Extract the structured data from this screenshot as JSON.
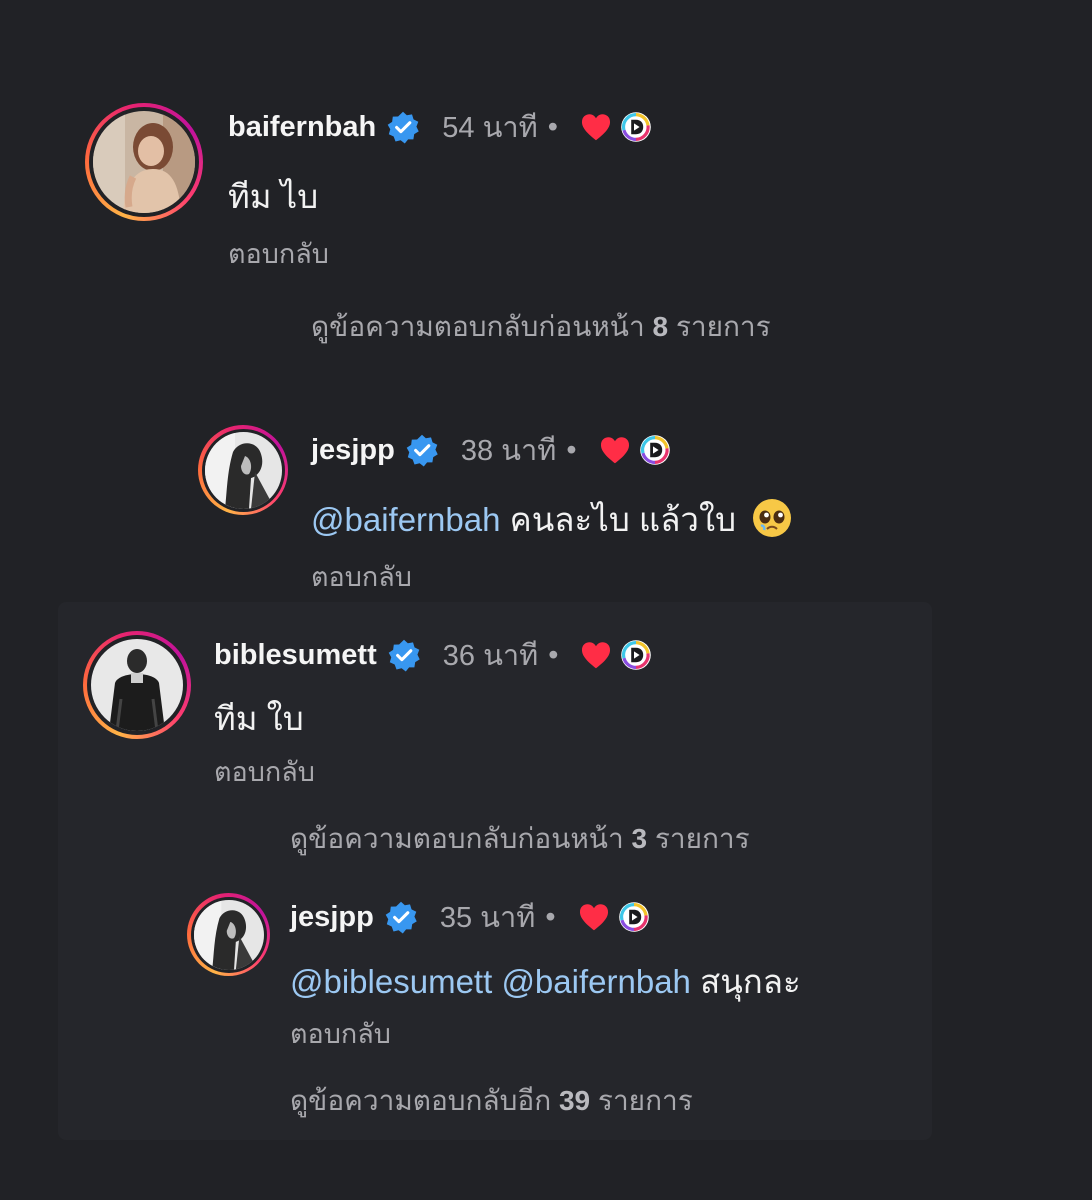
{
  "comments": [
    {
      "username": "baifernbah",
      "time": "54 นาที",
      "dot": "•",
      "text": "ทีม ไบ",
      "reply_label": "ตอบกลับ",
      "view_more_prefix": "ดูข้อความตอบกลับก่อนหน้า",
      "view_more_count": "8",
      "view_more_suffix": "รายการ"
    },
    {
      "username": "jesjpp",
      "time": "38 นาที",
      "dot": "•",
      "mention": "@baifernbah",
      "text": "คนละไบ แล้วใบ",
      "emoji_name": "pleading-face-emoji",
      "reply_label": "ตอบกลับ"
    },
    {
      "username": "biblesumett",
      "time": "36 นาที",
      "dot": "•",
      "text": "ทีม ใบ",
      "reply_label": "ตอบกลับ",
      "view_more_prefix": "ดูข้อความตอบกลับก่อนหน้า",
      "view_more_count": "3",
      "view_more_suffix": "รายการ"
    },
    {
      "username": "jesjpp",
      "time": "35 นาที",
      "dot": "•",
      "mention1": "@biblesumett",
      "mention2": "@baifernbah",
      "text": "สนุกละ",
      "reply_label": "ตอบกลับ",
      "view_more_prefix": "ดูข้อความตอบกลับอีก",
      "view_more_count": "39",
      "view_more_suffix": "รายการ"
    }
  ],
  "colors": {
    "background": "#212226",
    "mention": "#9cc8f2",
    "verified": "#3897f0",
    "heart": "#ff3040",
    "muted": "#a8a8ad"
  },
  "icons": [
    "verified-badge-icon",
    "heart-icon",
    "creator-liked-icon",
    "pleading-face-emoji"
  ]
}
